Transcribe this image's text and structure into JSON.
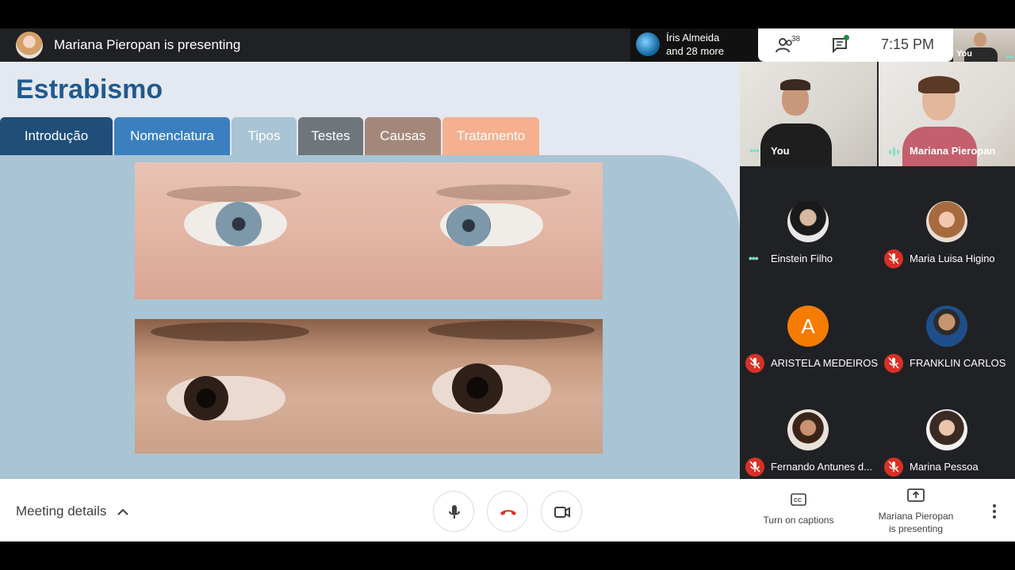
{
  "topbar": {
    "presenter_status": "Mariana Pieropan is presenting",
    "joined_line1": "Íris Almeida",
    "joined_line2": "and 28 more",
    "participant_count": "38",
    "clock": "7:15  PM",
    "self_label": "You"
  },
  "slide": {
    "title": "Estrabismo",
    "tabs": [
      {
        "label": "Introdução",
        "color": "#1f4e79"
      },
      {
        "label": "Nomenclatura",
        "color": "#3a80c1"
      },
      {
        "label": "Tipos",
        "color": "#a9c4d4"
      },
      {
        "label": "Testes",
        "color": "#6e767c"
      },
      {
        "label": "Causas",
        "color": "#a3887a"
      },
      {
        "label": "Tratamento",
        "color": "#f6b08f"
      }
    ]
  },
  "participants": {
    "video_tiles": [
      {
        "name": "You"
      },
      {
        "name": "Mariana Pieropan"
      }
    ],
    "tiles": [
      {
        "name": "Einstein Filho",
        "status": "speaking"
      },
      {
        "name": "Maria Luisa Higino",
        "status": "muted"
      },
      {
        "name": "ARISTELA MEDEIROS",
        "status": "muted",
        "initial": "A",
        "avatar_color": "#f57c00"
      },
      {
        "name": "FRANKLIN CARLOS",
        "status": "muted"
      },
      {
        "name": "Fernando Antunes d...",
        "status": "muted"
      },
      {
        "name": "Marina Pessoa",
        "status": "muted"
      }
    ]
  },
  "bottombar": {
    "meeting_details": "Meeting details",
    "captions_label": "Turn on captions",
    "presenting_line1": "Mariana Pieropan",
    "presenting_line2": "is presenting"
  },
  "colors": {
    "end_call_red": "#d93025",
    "accent_teal": "#7ee0c6",
    "bar_dark": "#202124"
  }
}
